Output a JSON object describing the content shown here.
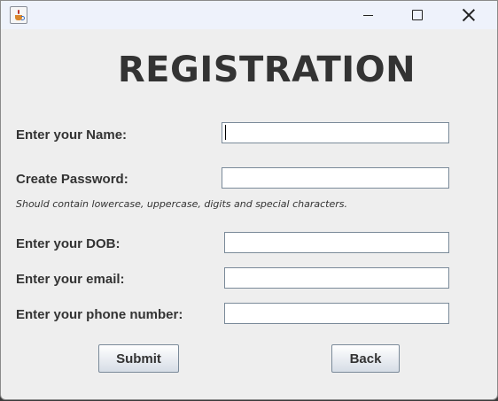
{
  "window": {
    "title": "",
    "icon": "java-cup-icon"
  },
  "heading": "REGISTRATION",
  "form": {
    "name_label": "Enter your Name:",
    "name_value": "",
    "password_label": "Create Password:",
    "password_value": "",
    "password_hint": "Should contain lowercase, uppercase, digits and special characters.",
    "dob_label": "Enter your DOB:",
    "dob_value": "",
    "email_label": "Enter your email:",
    "email_value": "",
    "phone_label": "Enter your phone number:",
    "phone_value": ""
  },
  "buttons": {
    "submit": "Submit",
    "back": "Back"
  }
}
